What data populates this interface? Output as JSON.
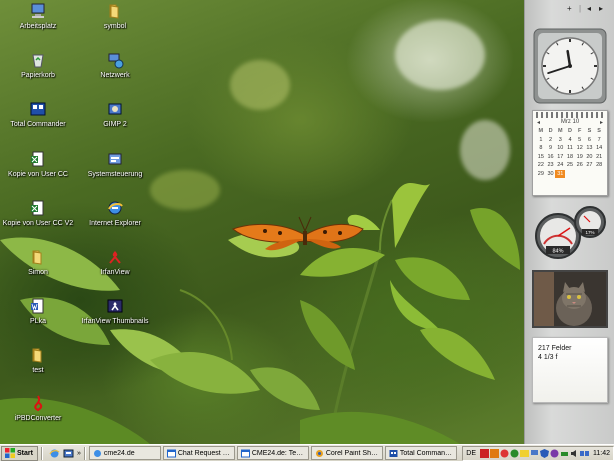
{
  "desktop": {
    "icons": [
      {
        "label": "Arbeitsplatz",
        "icon": "my-computer-icon"
      },
      {
        "label": "symbol",
        "icon": "folder-icon"
      },
      {
        "label": "Papierkorb",
        "icon": "recycle-bin-icon"
      },
      {
        "label": "Netzwerk",
        "icon": "network-icon"
      },
      {
        "label": "Total Commander",
        "icon": "total-commander-icon"
      },
      {
        "label": "GIMP 2",
        "icon": "gimp-icon"
      },
      {
        "label": "Kopie von User CC",
        "icon": "excel-document-icon"
      },
      {
        "label": "Systemsteuerung",
        "icon": "control-panel-icon"
      },
      {
        "label": "Kopie von User CC V2",
        "icon": "excel-document-icon"
      },
      {
        "label": "Internet Explorer",
        "icon": "internet-explorer-icon"
      },
      {
        "label": "Simon",
        "icon": "folder-icon"
      },
      {
        "label": "IrfanView",
        "icon": "irfanview-icon"
      },
      {
        "label": "PLka",
        "icon": "word-document-icon"
      },
      {
        "label": "IrfanView Thumbnails",
        "icon": "irfanview-thumbnails-icon"
      },
      {
        "label": "test",
        "icon": "folder-icon"
      },
      {
        "label": "iPBDConverter",
        "icon": "pdf-converter-icon"
      }
    ]
  },
  "sidebar": {
    "top_controls": [
      "+",
      "|",
      "◂",
      "▸"
    ],
    "clock": {
      "hour": 11,
      "minute": 42
    },
    "calendar": {
      "month_label": "Mrz 10",
      "prev": "◂",
      "next": "▸",
      "weekday_headers": [
        "M",
        "D",
        "M",
        "D",
        "F",
        "S",
        "S"
      ],
      "days": [
        "1",
        "2",
        "3",
        "4",
        "5",
        "6",
        "7",
        "8",
        "9",
        "10",
        "11",
        "12",
        "13",
        "14",
        "15",
        "16",
        "17",
        "18",
        "19",
        "20",
        "21",
        "22",
        "23",
        "24",
        "25",
        "26",
        "27",
        "28",
        "29",
        "30",
        "31"
      ],
      "leading_blanks": 0,
      "today": "31",
      "accent_color": "#f08a20"
    },
    "meters": {
      "cpu_label": "84%",
      "ram_label": "17%"
    },
    "photo": {
      "subject": "cat"
    },
    "notes": {
      "line1": "217 Felder",
      "line2": "4 1/3 f"
    }
  },
  "taskbar": {
    "start_label": "Start",
    "quick_launch": [
      "internet-explorer-icon",
      "show-desktop-icon"
    ],
    "more": "»",
    "tasks": [
      {
        "label": "cme24.de",
        "icon": "internet-explorer-icon"
      },
      {
        "label": "Chat Request Mon...",
        "icon": "window-icon"
      },
      {
        "label": "CME24.de: Testst...",
        "icon": "window-icon"
      },
      {
        "label": "Corel Paint Shop P...",
        "icon": "paint-shop-icon"
      },
      {
        "label": "Total Commander ...",
        "icon": "total-commander-icon"
      }
    ],
    "language": "DE",
    "time": "11:42"
  }
}
